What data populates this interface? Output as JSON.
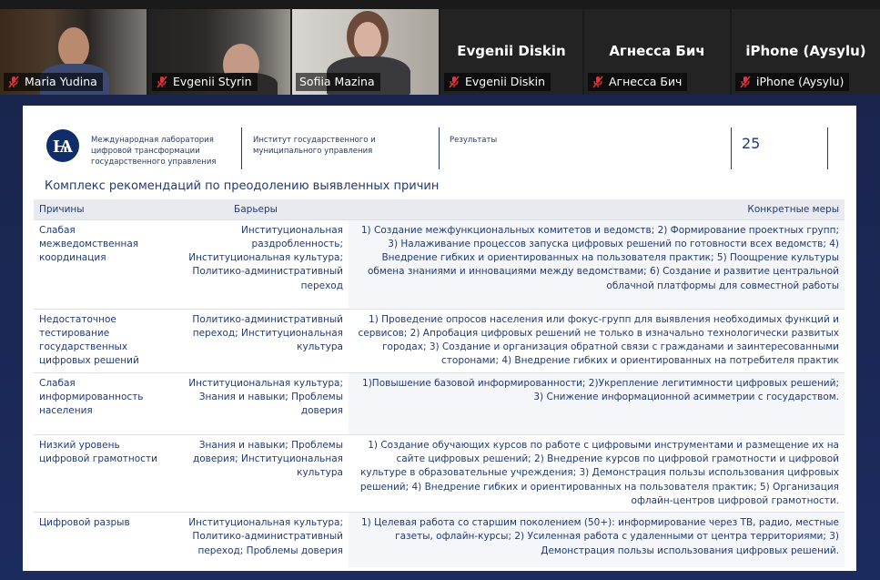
{
  "participants": [
    {
      "name": "Maria Yudina",
      "muted": true,
      "video": true
    },
    {
      "name": "Evgenii Styrin",
      "muted": true,
      "video": true
    },
    {
      "name": "Sofiia Mazina",
      "muted": false,
      "video": true,
      "active": true
    },
    {
      "name": "Evgenii Diskin",
      "muted": true,
      "video": false
    },
    {
      "name": "Агнесса Бич",
      "muted": true,
      "video": false
    },
    {
      "name": "iPhone (Aysylu)",
      "muted": true,
      "video": false
    }
  ],
  "slide": {
    "logo_text": "Ѩ",
    "header": {
      "lab": "Международная лаборатория\nцифровой трансформации\nгосударственного управления",
      "institute": "Институт государственного и\nмуниципального управления",
      "section": "Результаты",
      "page": "25"
    },
    "title": "Комплекс рекомендаций по преодолению выявленных причин",
    "table": {
      "headers": [
        "Причины",
        "Барьеры",
        "Конкретные меры"
      ],
      "rows": [
        {
          "cause": "Слабая межведомственная координация",
          "barriers": "Институциональная раздробленность; Институциональная культура; Политико-административный переход",
          "measures": "1) Создание межфункциональных комитетов и ведомств;   2) Формирование проектных групп; 3) Налаживание процессов запуска цифровых решений по готовности всех ведомств;  4) Внедрение гибких и ориентированных на пользователя практик; 5) Поощрение культуры обмена знаниями и инновациями между ведомствами; 6) Создание и развитие центральной облачной платформы для совместной работы"
        },
        {
          "cause": "Недостаточное тестирование государственных цифровых решений",
          "barriers": "Политико-административный переход;  Институциональная культура",
          "measures": "1) Проведение опросов населения или фокус-групп для выявления необходимых функций и сервисов; 2) Апробация цифровых решений не только в изначально технологически развитых городах; 3) Создание и организация обратной связи с гражданами и заинтересованными сторонами; 4) Внедрение гибких и ориентированных на потребителя практик"
        },
        {
          "cause": "Слабая информированность населения",
          "barriers": "Институциональная культура; Знания и навыки; Проблемы доверия",
          "measures": "1)Повышение базовой информированности; 2)Укрепление легитимности цифровых решений; 3) Снижение информационной асимметрии с государством."
        },
        {
          "cause": "Низкий уровень цифровой грамотности",
          "barriers": "Знания и навыки; Проблемы доверия; Институциональная культура",
          "measures": "1) Создание обучающих курсов по работе с цифровыми инструментами и размещение их на сайте цифровых решений; 2) Внедрение курсов по цифровой грамотности и цифровой культуре в образовательные учреждения; 3) Демонстрация пользы использования цифровых решений; 4) Внедрение гибких и ориентированных на пользователя практик; 5) Организация офлайн-центров цифровой грамотности."
        },
        {
          "cause": "Цифровой разрыв",
          "barriers": "Институциональная культура; Политико-административный переход; Проблемы доверия",
          "measures": "1) Целевая работа со старшим поколением (50+): информирование через ТВ, радио, местные газеты, офлайн-курсы; 2) Усиленная работа с удаленными от центра территориями; 3) Демонстрация пользы использования цифровых решений."
        }
      ]
    }
  },
  "colors": {
    "active_speaker": "#2ad35a",
    "muted_mic": "#e0343a",
    "slide_text": "#1f3b73",
    "background": "#1a1a1a"
  }
}
